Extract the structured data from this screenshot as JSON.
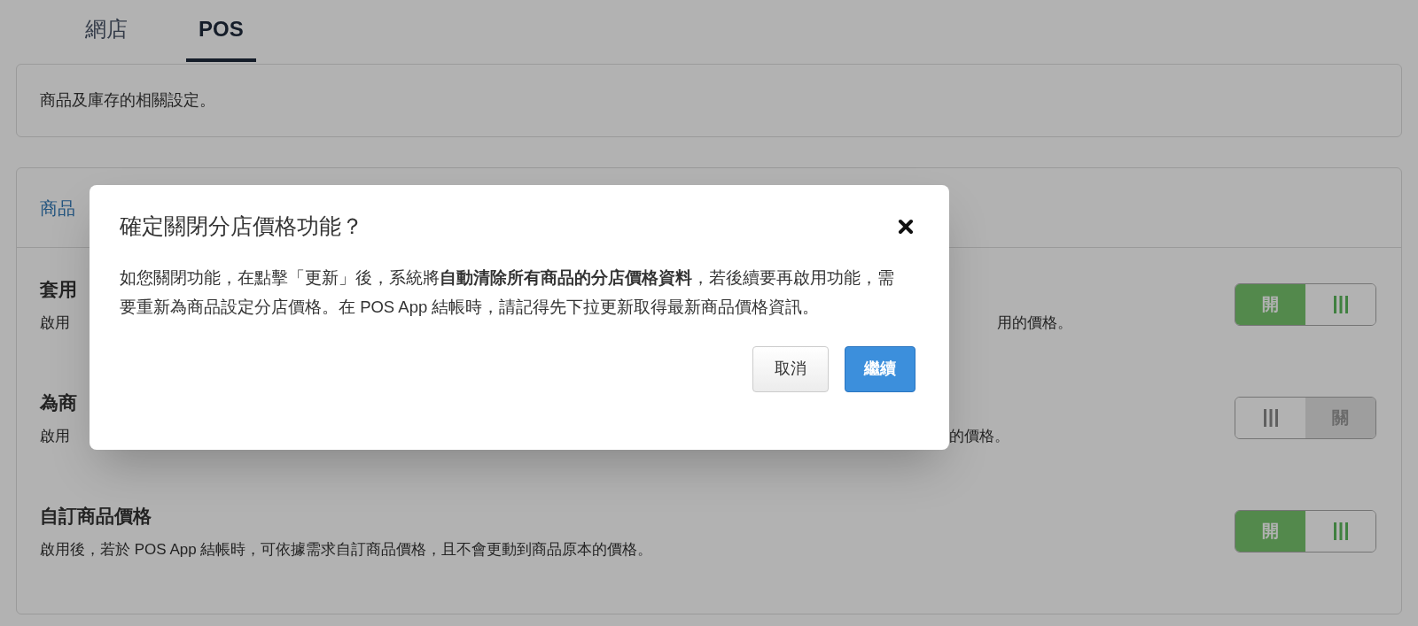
{
  "tabs": [
    {
      "label": "網店",
      "selected": false
    },
    {
      "label": "POS",
      "selected": true
    }
  ],
  "intro": "商品及庫存的相關設定。",
  "section": {
    "title": "商品",
    "settings": [
      {
        "title": "套用",
        "description": "啟用",
        "description_end": "用的價格。",
        "on": true,
        "toggle_label": "開"
      },
      {
        "title": "為商",
        "description": "啟用",
        "description_end": "的價格。",
        "on": false,
        "toggle_label": "關"
      },
      {
        "title": "自訂商品價格",
        "description": "啟用後，若於 POS App 結帳時，可依據需求自訂商品價格，且不會更動到商品原本的價格。",
        "on": true,
        "toggle_label": "開"
      }
    ]
  },
  "dialog": {
    "title": "確定關閉分店價格功能？",
    "body": "如您關閉功能，在點擊「更新」後，系統將**自動清除所有商品的分店價格資料**，若後續要再啟用功能，需要重新為商品設定分店價格。在 POS App 結帳時，請記得先下拉更新取得最新商品價格資訊。",
    "buttons": [
      {
        "label": "取消",
        "kind": "secondary"
      },
      {
        "label": "繼續",
        "kind": "primary"
      }
    ]
  }
}
